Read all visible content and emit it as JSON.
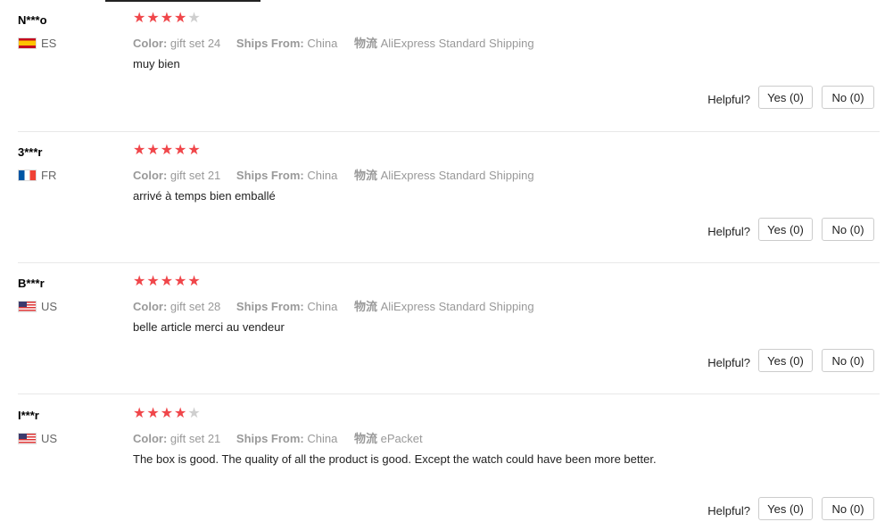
{
  "colors": {
    "star_on": "#f0464a",
    "star_off": "#cfcfcf",
    "meta_text": "#999999"
  },
  "helpful_label": "Helpful?",
  "meta_labels": {
    "color": "Color:",
    "ships_from": "Ships From:",
    "shipping": "物流"
  },
  "reviews": [
    {
      "name": "N***o",
      "country": "ES",
      "flag": "spain-flag-icon",
      "rating": 4,
      "color": "gift set 24",
      "ships_from": "China",
      "shipping": "AliExpress Standard Shipping",
      "text": "muy bien",
      "yes": "Yes (0)",
      "no": "No (0)"
    },
    {
      "name": "3***r",
      "country": "FR",
      "flag": "france-flag-icon",
      "rating": 5,
      "color": "gift set 21",
      "ships_from": "China",
      "shipping": "AliExpress Standard Shipping",
      "text": "arrivé à temps bien emballé",
      "yes": "Yes (0)",
      "no": "No (0)"
    },
    {
      "name": "B***r",
      "country": "US",
      "flag": "usa-flag-icon",
      "rating": 5,
      "color": "gift set 28",
      "ships_from": "China",
      "shipping": "AliExpress Standard Shipping",
      "text": "belle article merci au vendeur",
      "yes": "Yes (0)",
      "no": "No (0)"
    },
    {
      "name": "I***r",
      "country": "US",
      "flag": "usa-flag-icon",
      "rating": 4,
      "color": "gift set 21",
      "ships_from": "China",
      "shipping": "ePacket",
      "text": "The box is good. The quality of all the product is good. Except the watch could have been more better.",
      "yes": "Yes (0)",
      "no": "No (0)"
    }
  ]
}
